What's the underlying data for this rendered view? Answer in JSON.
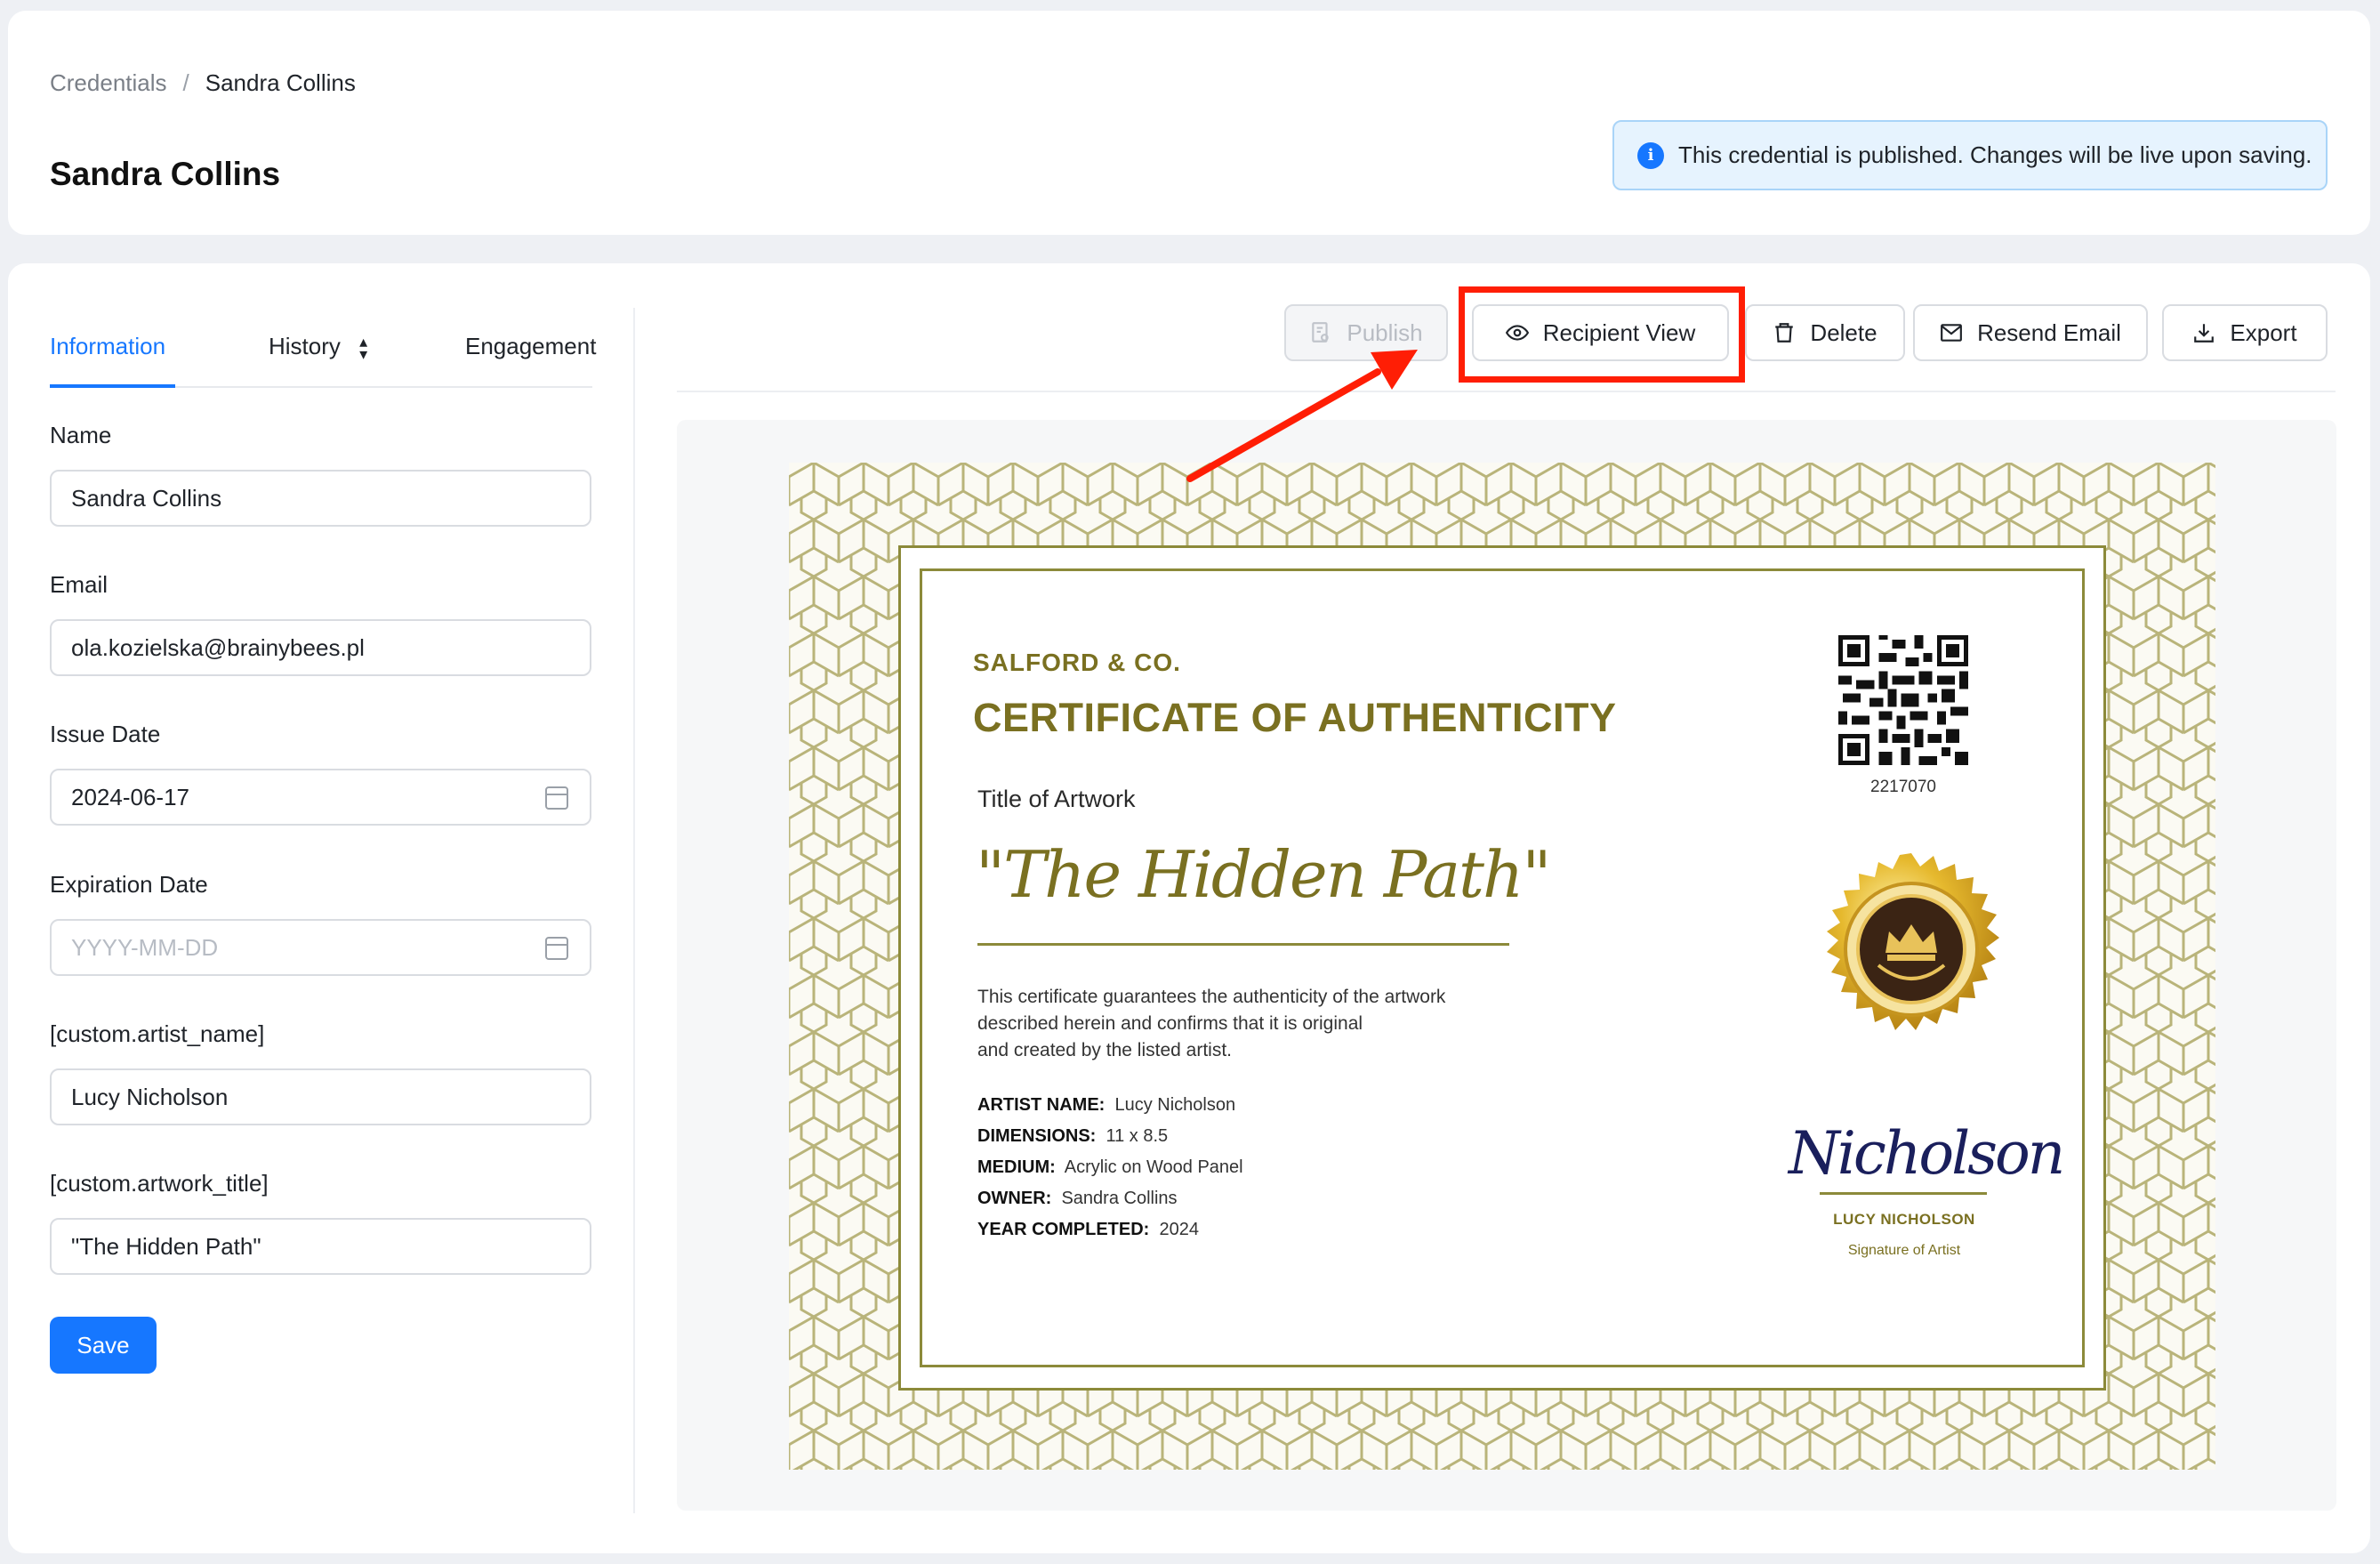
{
  "breadcrumb": {
    "parent": "Credentials",
    "separator": "/",
    "current": "Sandra Collins"
  },
  "page_title": "Sandra Collins",
  "alert": {
    "text": "This credential is published. Changes will be live upon saving.",
    "icon": "info-icon"
  },
  "tabs": [
    {
      "label": "Information",
      "active": true
    },
    {
      "label": "History"
    },
    {
      "label": "Engagement"
    }
  ],
  "form": {
    "name": {
      "label": "Name",
      "value": "Sandra Collins"
    },
    "email": {
      "label": "Email",
      "value": "ola.kozielska@brainybees.pl"
    },
    "issue_date": {
      "label": "Issue Date",
      "value": "2024-06-17"
    },
    "expiration_date": {
      "label": "Expiration Date",
      "placeholder": "YYYY-MM-DD"
    },
    "artist_name": {
      "label": "[custom.artist_name]",
      "value": "Lucy Nicholson"
    },
    "artwork_title": {
      "label": "[custom.artwork_title]",
      "value": "\"The Hidden Path\""
    },
    "save_label": "Save"
  },
  "toolbar": {
    "publish": "Publish",
    "recipient_view": "Recipient View",
    "delete": "Delete",
    "resend_email": "Resend Email",
    "export": "Export"
  },
  "certificate": {
    "company": "SALFORD & CO.",
    "title": "CERTIFICATE OF AUTHENTICITY",
    "artwork_label": "Title of Artwork",
    "artwork_title": "\"The Hidden Path\"",
    "description_lines": [
      "This certificate guarantees the authenticity of the artwork",
      "described herein and confirms that it is original",
      "and created by the listed artist."
    ],
    "details": [
      {
        "key": "ARTIST NAME:",
        "value": "Lucy Nicholson"
      },
      {
        "key": "DIMENSIONS:",
        "value": "11 x 8.5"
      },
      {
        "key": "MEDIUM:",
        "value": "Acrylic on Wood Panel"
      },
      {
        "key": "OWNER:",
        "value": "Sandra Collins"
      },
      {
        "key": "YEAR COMPLETED:",
        "value": "2024"
      }
    ],
    "qr_number": "2217070",
    "signature": "Nicholson",
    "signer_name": "LUCY NICHOLSON",
    "signer_caption": "Signature of Artist",
    "accent_color": "#7a7021"
  },
  "colors": {
    "primary": "#1677ff",
    "highlight": "#ff1e05"
  }
}
